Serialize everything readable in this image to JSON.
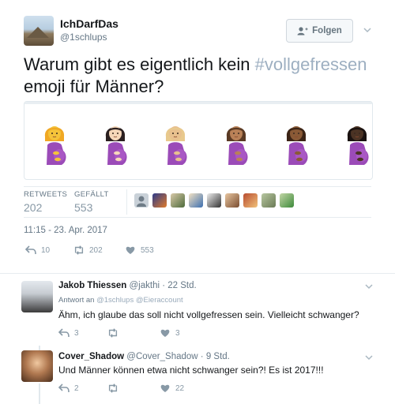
{
  "tweet": {
    "display_name": "IchDarfDas",
    "handle": "@1schlups",
    "follow_label": "Folgen",
    "text_before": "Warum gibt es eigentlich kein ",
    "hashtag": "#vollgefressen",
    "text_after": " emoji für Männer?",
    "retweets_label": "RETWEETS",
    "retweets_count": "202",
    "likes_label": "GEFÄLLT",
    "likes_count": "553",
    "timestamp": "11:15 - 23. Apr. 2017",
    "actions": {
      "replies": "10",
      "retweets": "202",
      "likes": "553"
    },
    "emoji_skin_tones": [
      "#f4c33a",
      "#f6d7b9",
      "#e8c08e",
      "#b98157",
      "#8a5a36",
      "#4b3324"
    ],
    "emoji_hair_colors": [
      "#f0a824",
      "#2b2020",
      "#e8c98d",
      "#5a3a24",
      "#3b2416",
      "#1a1210"
    ],
    "accent_purple": "#9b4bb8"
  },
  "replies": [
    {
      "name": "Jakob Thiessen",
      "handle": "@jakthi",
      "time": "· 22 Std.",
      "reply_prefix": "Antwort an",
      "reply_to": "@1schlups @Eieraccount",
      "text": "Ähm, ich glaube das soll nicht vollgefressen sein. Vielleicht schwanger?",
      "actions": {
        "replies": "3",
        "retweets": "",
        "likes": "3"
      }
    },
    {
      "name": "Cover_Shadow",
      "handle": "@Cover_Shadow",
      "time": "· 9 Std.",
      "text": "Und Männer können etwa nicht schwanger sein?! Es ist 2017!!!",
      "actions": {
        "replies": "2",
        "retweets": "",
        "likes": "22"
      }
    }
  ]
}
